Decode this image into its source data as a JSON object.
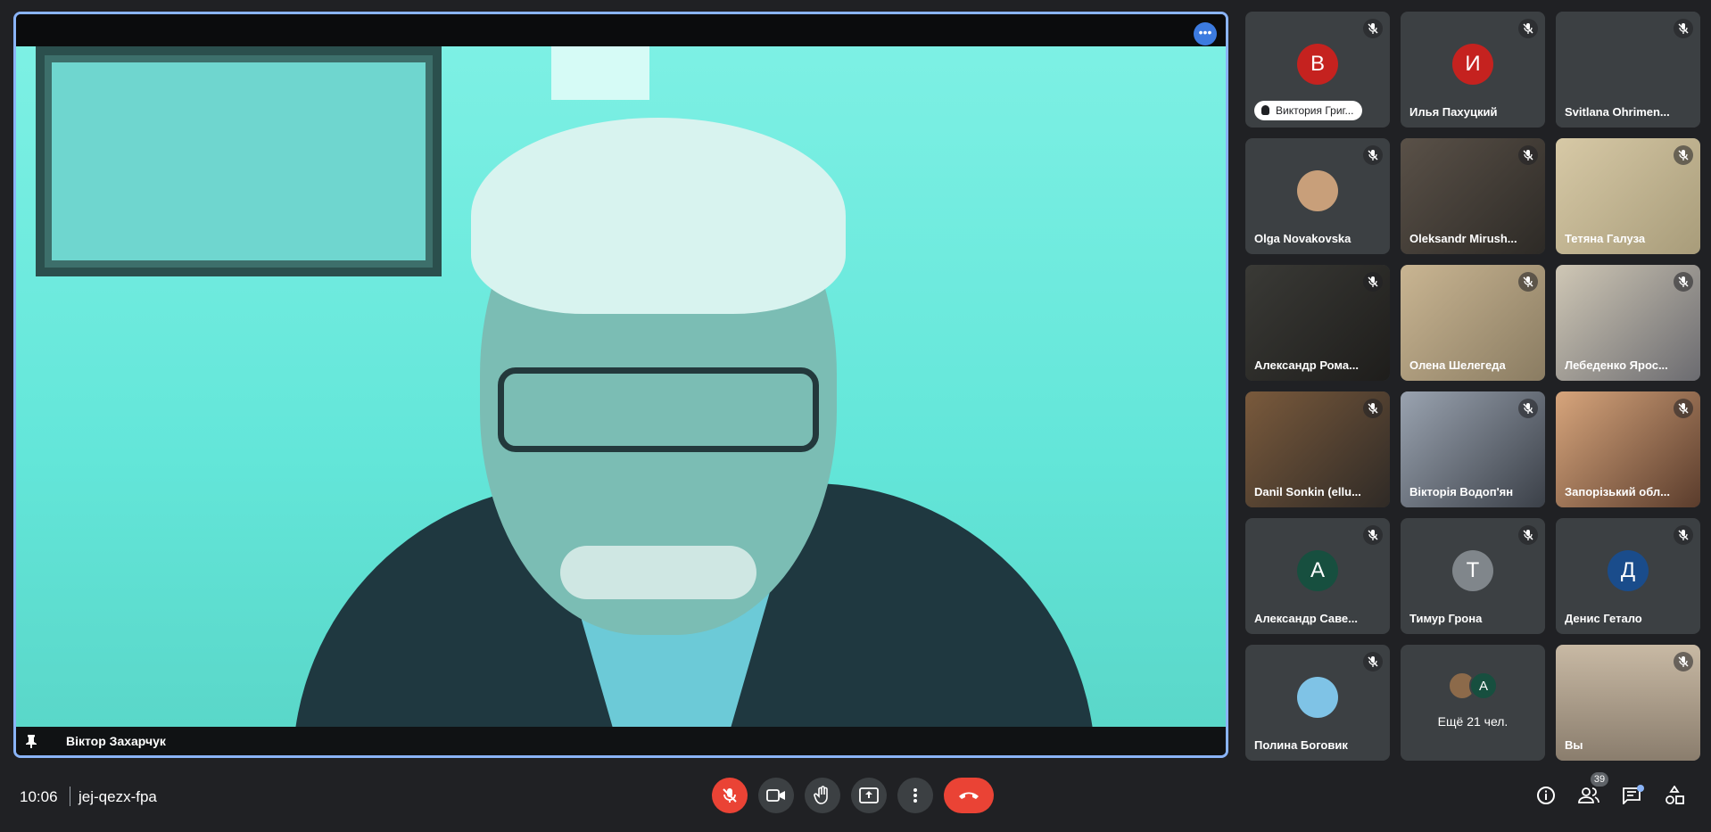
{
  "colors": {
    "accent": "#8ab4f8",
    "danger": "#ea4335",
    "tile_bg": "#3c4043",
    "background": "#202124"
  },
  "main_speaker": {
    "name": "Віктор Захарчук"
  },
  "participants": [
    {
      "name": "Виктория Григ...",
      "initial": "В",
      "color": "#c5221f",
      "badge": true
    },
    {
      "name": "Илья Пахуцкий",
      "initial": "И",
      "color": "#c5221f"
    },
    {
      "name": "Svitlana Ohrimen..."
    },
    {
      "name": "Olga Novakovska"
    },
    {
      "name": "Oleksandr Mirush..."
    },
    {
      "name": "Тетяна Галуза"
    },
    {
      "name": "Александр Рома..."
    },
    {
      "name": "Олена Шелегеда"
    },
    {
      "name": "Лебеденко Ярос..."
    },
    {
      "name": "Danil Sonkin (ellu..."
    },
    {
      "name": "Вікторія Водоп'ян"
    },
    {
      "name": "Запорізький обл..."
    },
    {
      "name": "Александр Саве...",
      "initial": "А",
      "color": "#174f3f"
    },
    {
      "name": "Тимур Грона",
      "initial": "Т",
      "color": "#80868b"
    },
    {
      "name": "Денис Гетало",
      "initial": "Д",
      "color": "#1a4c8b"
    },
    {
      "name": "Полина Боговик"
    },
    {
      "name": "Вы"
    }
  ],
  "more_tile": {
    "text": "Ещё 21 чел.",
    "avatar_initial": "А"
  },
  "meeting": {
    "time": "10:06",
    "code": "jej-qezx-fpa"
  },
  "toolbar": {
    "mic": "mic-off-icon",
    "camera": "video-camera-icon",
    "raise_hand": "hand-icon",
    "present": "present-screen-icon",
    "more": "more-vert-icon",
    "leave": "call-end-icon"
  },
  "right_controls": {
    "people_count": "39"
  }
}
